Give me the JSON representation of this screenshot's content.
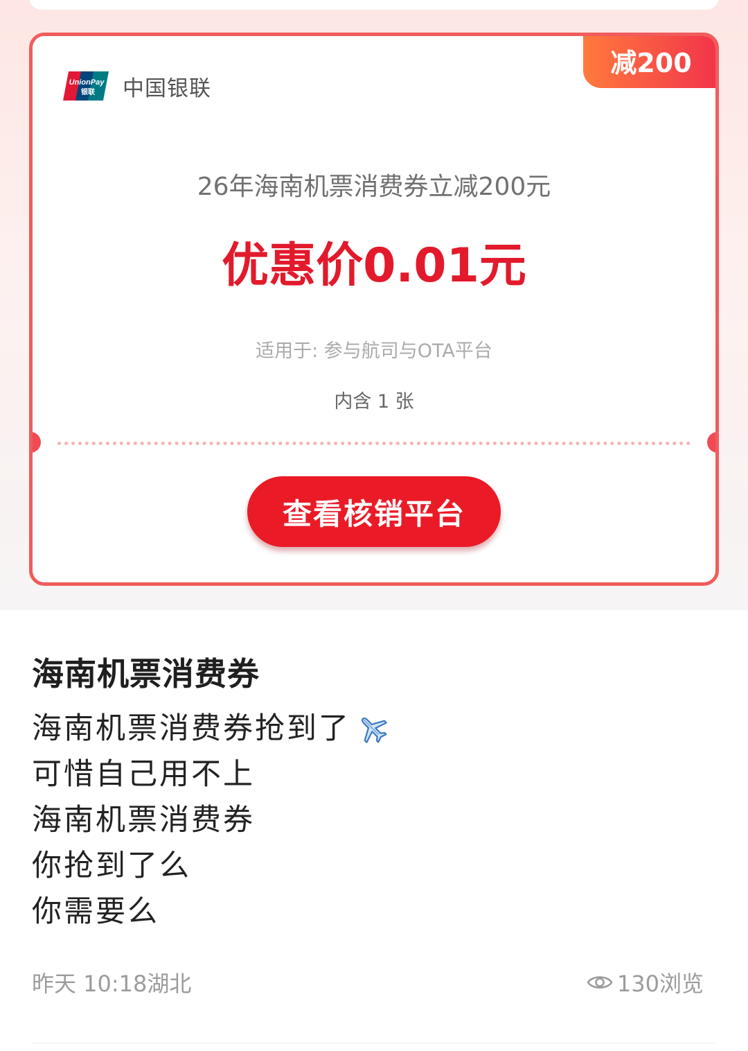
{
  "coupon": {
    "badge": "减200",
    "brand": {
      "logo_text_top": "UnionPay",
      "logo_text_bottom": "银联",
      "name": "中国银联"
    },
    "title": "26年海南机票消费券立减200元",
    "price": "优惠价0.01元",
    "scope": "适用于: 参与航司与OTA平台",
    "count": "内含 1 张",
    "cta_label": "查看核销平台"
  },
  "post": {
    "title": "海南机票消费券",
    "lines": [
      "海南机票消费券抢到了",
      "可惜自己用不上",
      "海南机票消费券",
      "你抢到了么",
      "你需要么"
    ],
    "time_location": "昨天 10:18湖北",
    "views": "130浏览"
  },
  "icons": {
    "unionpay_logo": "unionpay-logo",
    "plane": "airplane-icon",
    "views": "eye-icon"
  },
  "colors": {
    "accent_red": "#e21a2c",
    "border_red": "#f05c5c",
    "badge_gradient_start": "#ff7a3d",
    "badge_gradient_end": "#f2334b"
  }
}
